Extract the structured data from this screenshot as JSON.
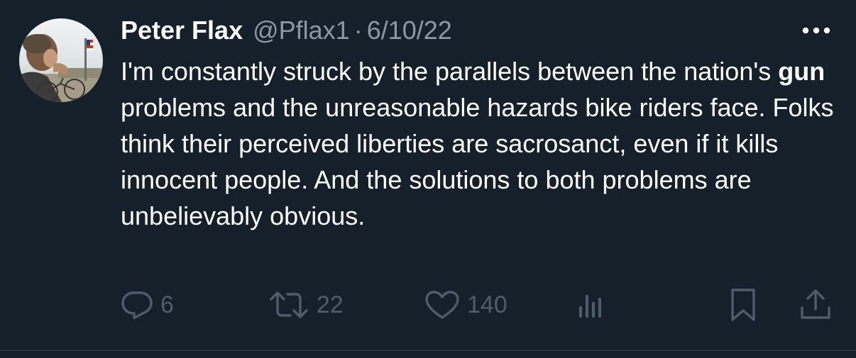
{
  "tweet": {
    "author_name": "Peter Flax",
    "handle": "@Pflax1",
    "separator": "·",
    "date": "6/10/22",
    "text_before": "I'm constantly struck by the parallels between the nation's ",
    "text_bold": "gun",
    "text_after": " problems and the unreasonable hazards bike riders face. Folks think their perceived liberties are sacrosanct, even if it kills innocent people. And the solutions to both problems are unbelievably obvious."
  },
  "actions": {
    "reply_count": "6",
    "retweet_count": "22",
    "like_count": "140"
  },
  "icons": {
    "more": "more-horizontal-icon",
    "reply": "reply-icon",
    "retweet": "retweet-icon",
    "like": "heart-icon",
    "analytics": "analytics-icon",
    "bookmark": "bookmark-icon",
    "share": "share-icon"
  },
  "colors": {
    "background": "#15202b",
    "text": "#ffffff",
    "secondary_text": "#8b98a5",
    "action_icons": "#4e5d6b"
  }
}
